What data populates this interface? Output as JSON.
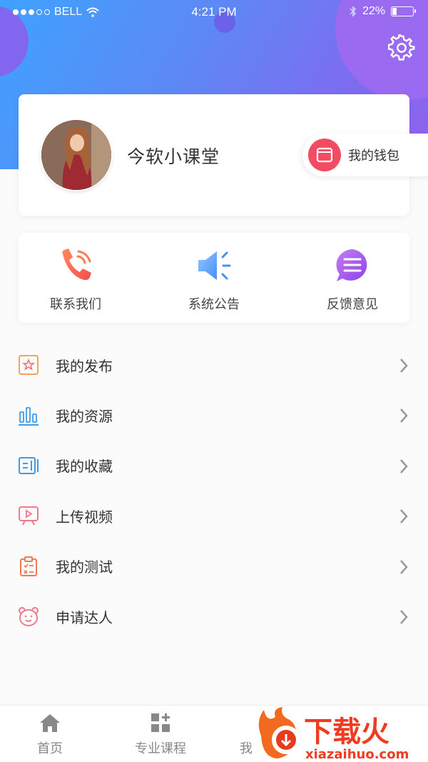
{
  "status_bar": {
    "carrier": "BELL",
    "time": "4:21 PM",
    "battery": "22%",
    "battery_level": 0.22
  },
  "header": {
    "settings_icon": "gear-icon"
  },
  "profile": {
    "username": "今软小课堂",
    "wallet_label": "我的钱包"
  },
  "quick_actions": [
    {
      "label": "联系我们",
      "icon": "phone-icon"
    },
    {
      "label": "系统公告",
      "icon": "speaker-icon"
    },
    {
      "label": "反馈意见",
      "icon": "message-icon"
    }
  ],
  "menu": [
    {
      "label": "我的发布",
      "icon": "star-icon"
    },
    {
      "label": "我的资源",
      "icon": "bar-chart-icon"
    },
    {
      "label": "我的收藏",
      "icon": "collection-icon"
    },
    {
      "label": "上传视频",
      "icon": "video-icon"
    },
    {
      "label": "我的测试",
      "icon": "clipboard-icon"
    },
    {
      "label": "申请达人",
      "icon": "bear-icon"
    }
  ],
  "tabs": [
    {
      "label": "首页",
      "icon": "home-icon"
    },
    {
      "label": "专业课程",
      "icon": "grid-plus-icon"
    },
    {
      "label": "我",
      "icon": "profile-icon"
    }
  ],
  "watermark": {
    "title": "下载火",
    "url": "xiazaihuo.com"
  },
  "colors": {
    "gradient_start": "#3fa2ff",
    "gradient_end": "#8f62ee",
    "wallet_red": "#f34b62"
  }
}
